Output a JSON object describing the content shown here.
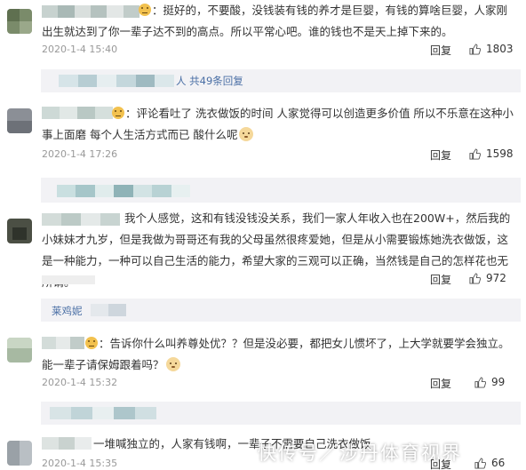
{
  "comments": [
    {
      "text": "：挺好的，不要酸，没钱装有钱的养才是巨婴，有钱的算啥巨婴，人家刚出生就达到了你一辈子达不到的高点。所以平常心吧。谁的钱也不是天上掉下来的。",
      "timestamp": "2020-1-4 15:40",
      "likes": "1803"
    },
    {
      "text": "：评论看吐了 洗衣做饭的时间 人家觉得可以创造更多价值 所以不乐意在这种小事上面磨 每个人生活方式而已 酸什么呢",
      "timestamp": "2020-1-4 17:26",
      "likes": "1598"
    },
    {
      "text": "我个人感觉，这和有钱没钱没关系，我们一家人年收入也在200W+，然后我的小妹妹才九岁，但是我做为哥哥还有我的父母虽然很疼爱她，但是从小需要锻炼她洗衣做饭，这是一种能力，一种可以自己生活的能力，希望大家的三观可以正确，当然钱是自己的怎样花也无所谓。",
      "likes": "972"
    },
    {
      "text": "：告诉你什么叫养尊处优？？但是没必要，都把女儿惯坏了，上大学就要学会独立。能一辈子请保姆跟着吗？",
      "timestamp": "2020-1-4 15:32",
      "likes": "99"
    },
    {
      "text": "一堆喊独立的，人家有钱啊，一辈子不需要自己洗衣做饭",
      "timestamp": "2020-1-4 15:35",
      "likes": "66"
    }
  ],
  "reply_label": "回复",
  "subreplies": {
    "first": "人 共49条回复",
    "third": "莱鸡妮"
  },
  "watermark": "快传号／涉丹体育视界"
}
